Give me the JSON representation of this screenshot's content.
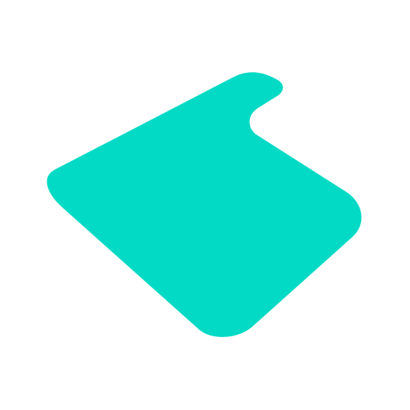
{
  "background_color": "#ffffff",
  "shape": {
    "icon": "isometric-rounded-tile-icon",
    "fill_color": "#02dac5"
  }
}
